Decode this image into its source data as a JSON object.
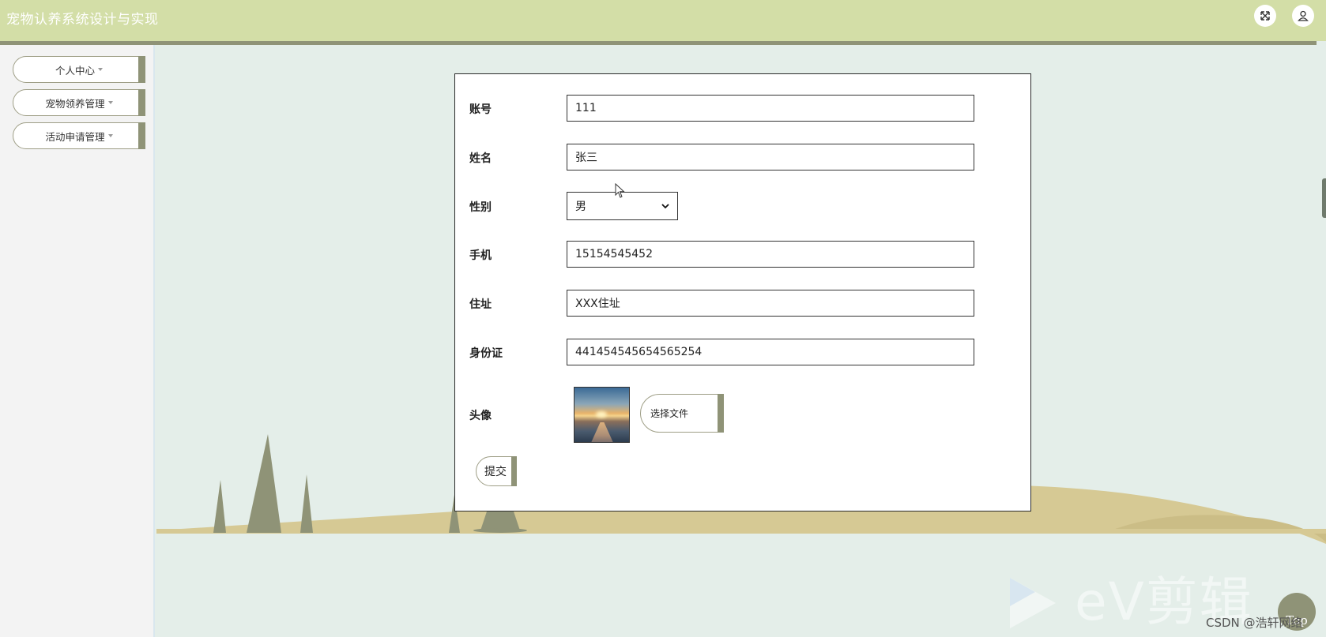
{
  "header": {
    "title": "宠物认养系统设计与实现",
    "icons": [
      "fullscreen-icon",
      "user-icon"
    ]
  },
  "sidebar": {
    "items": [
      {
        "label": "个人中心"
      },
      {
        "label": "宠物领养管理"
      },
      {
        "label": "活动申请管理"
      }
    ]
  },
  "form": {
    "fields": [
      {
        "label": "账号",
        "value": "111"
      },
      {
        "label": "姓名",
        "value": "张三"
      },
      {
        "label": "性别",
        "value": "男"
      },
      {
        "label": "手机",
        "value": "15154545452"
      },
      {
        "label": "住址",
        "value": "XXX住址"
      },
      {
        "label": "身份证",
        "value": "441454545654565254"
      }
    ],
    "avatar_label": "头像",
    "file_button": "选择文件",
    "submit_button": "提交"
  },
  "overlay": {
    "top_button": "Top",
    "watermark": "CSDN @浩轩网络",
    "video_logo": "eV剪辑"
  },
  "colors": {
    "header_bg": "#d3dea7",
    "accent": "#8f9377",
    "sidebar_bg": "#f3f3f3",
    "page_bg": "#e4eee9",
    "hill": "#d6c994"
  }
}
